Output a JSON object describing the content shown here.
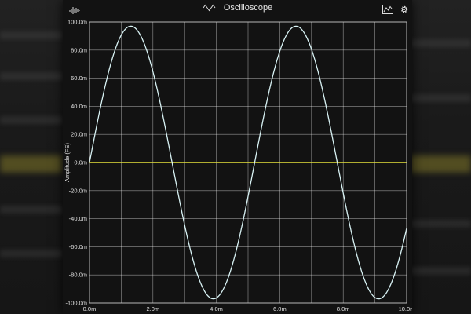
{
  "window": {
    "title": "Oscilloscope",
    "icons": {
      "left": "waveform-bars-icon",
      "title": "sine-wave-icon",
      "chart": "trace-chart-icon",
      "settings": "gear-icon"
    }
  },
  "colors": {
    "trace": "#d8f2f4",
    "baseline": "#e6e23a",
    "grid": "#ffffff"
  },
  "chart_data": {
    "type": "line",
    "ylabel": "Amplitude (FS)",
    "xlim": [
      0.0,
      0.01
    ],
    "ylim": [
      -0.1,
      0.1
    ],
    "xticks": [
      0.0,
      0.001,
      0.002,
      0.003,
      0.004,
      0.005,
      0.006,
      0.007,
      0.008,
      0.009,
      0.01
    ],
    "xtick_labels": [
      "0.0m",
      "",
      "2.0m",
      "",
      "4.0m",
      "",
      "6.0m",
      "",
      "8.0m",
      "",
      "10.0m"
    ],
    "yticks": [
      0.1,
      0.08,
      0.06,
      0.04,
      0.02,
      0.0,
      -0.02,
      -0.04,
      -0.06,
      -0.08,
      -0.1
    ],
    "ytick_labels": [
      "100.0m",
      "80.0m",
      "60.0m",
      "40.0m",
      "20.0m",
      "0.0m",
      "-20.0m",
      "-40.0m",
      "-60.0m",
      "-80.0m",
      "-100.0m"
    ],
    "grid": true,
    "series": [
      {
        "waveform": "sine",
        "amplitude": 0.097,
        "frequency_hz": 192,
        "offset": 0.0
      },
      {
        "x": [
          0.0,
          0.01
        ],
        "y": [
          0.0,
          0.0
        ]
      }
    ]
  }
}
